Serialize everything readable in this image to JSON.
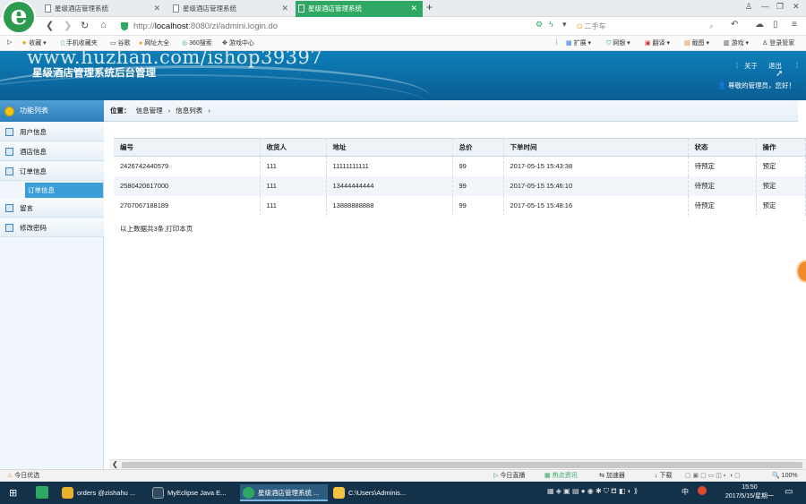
{
  "browser": {
    "tabs": [
      {
        "label": "星级酒店管理系统"
      },
      {
        "label": "星级酒店管理系统"
      },
      {
        "label": "星级酒店管理系统",
        "active": true
      }
    ],
    "url_host": "localhost",
    "url_rest": ":8080/zi/admini.login.do",
    "search_placeholder": "二手车",
    "bookmarks": [
      "收藏",
      "手机收藏夹",
      "谷歌",
      "网址大全",
      "360搜索",
      "游戏中心"
    ],
    "toolbar_right": [
      "扩展",
      "网银",
      "翻译",
      "截图",
      "游戏",
      "登录管家"
    ]
  },
  "header": {
    "watermark": "www.huzhan.com/ishop39397",
    "system_title": "星级酒店管理系统后台管理",
    "about_link": "关于",
    "logout_link": "退出",
    "greeting": "尊敬的管理员，您好！"
  },
  "sidebar": {
    "title": "功能列表",
    "items": [
      {
        "label": "用户信息"
      },
      {
        "label": "酒店信息"
      },
      {
        "label": "订单信息"
      },
      {
        "label": "订单信息"
      },
      {
        "label": "留言"
      },
      {
        "label": "修改密码"
      }
    ]
  },
  "breadcrumb": {
    "prefix": "位置：",
    "level1": "信息管理",
    "level2": "信息列表"
  },
  "table": {
    "columns": [
      "编号",
      "收货人",
      "地址",
      "总价",
      "下单时间",
      "状态",
      "操作"
    ],
    "rows": [
      [
        "2426742440579",
        "111",
        "11111111111",
        "99",
        "2017-05-15 15:43:38",
        "待预定",
        "预定"
      ],
      [
        "2580420617000",
        "111",
        "13444444444",
        "99",
        "2017-05-15 15:46:10",
        "待预定",
        "预定"
      ],
      [
        "2707067188189",
        "111",
        "13888888888",
        "99",
        "2017-05-15 15:48:16",
        "待预定",
        "预定"
      ]
    ],
    "footer_note": "以上数据共3条,打印本页"
  },
  "statusbar": {
    "left": "今日优选",
    "items": [
      "今日直播",
      "热点资讯",
      "加速器",
      "下载"
    ],
    "zoom": "100%"
  },
  "taskbar": {
    "items": [
      {
        "label": "orders @zishahu ..."
      },
      {
        "label": "MyEclipse Java E..."
      },
      {
        "label": "星级酒店管理系统 ..."
      },
      {
        "label": "C:\\Users\\Adminis..."
      }
    ],
    "time": "15:50",
    "date": "2017/5/15/星期一",
    "ime": "中"
  }
}
